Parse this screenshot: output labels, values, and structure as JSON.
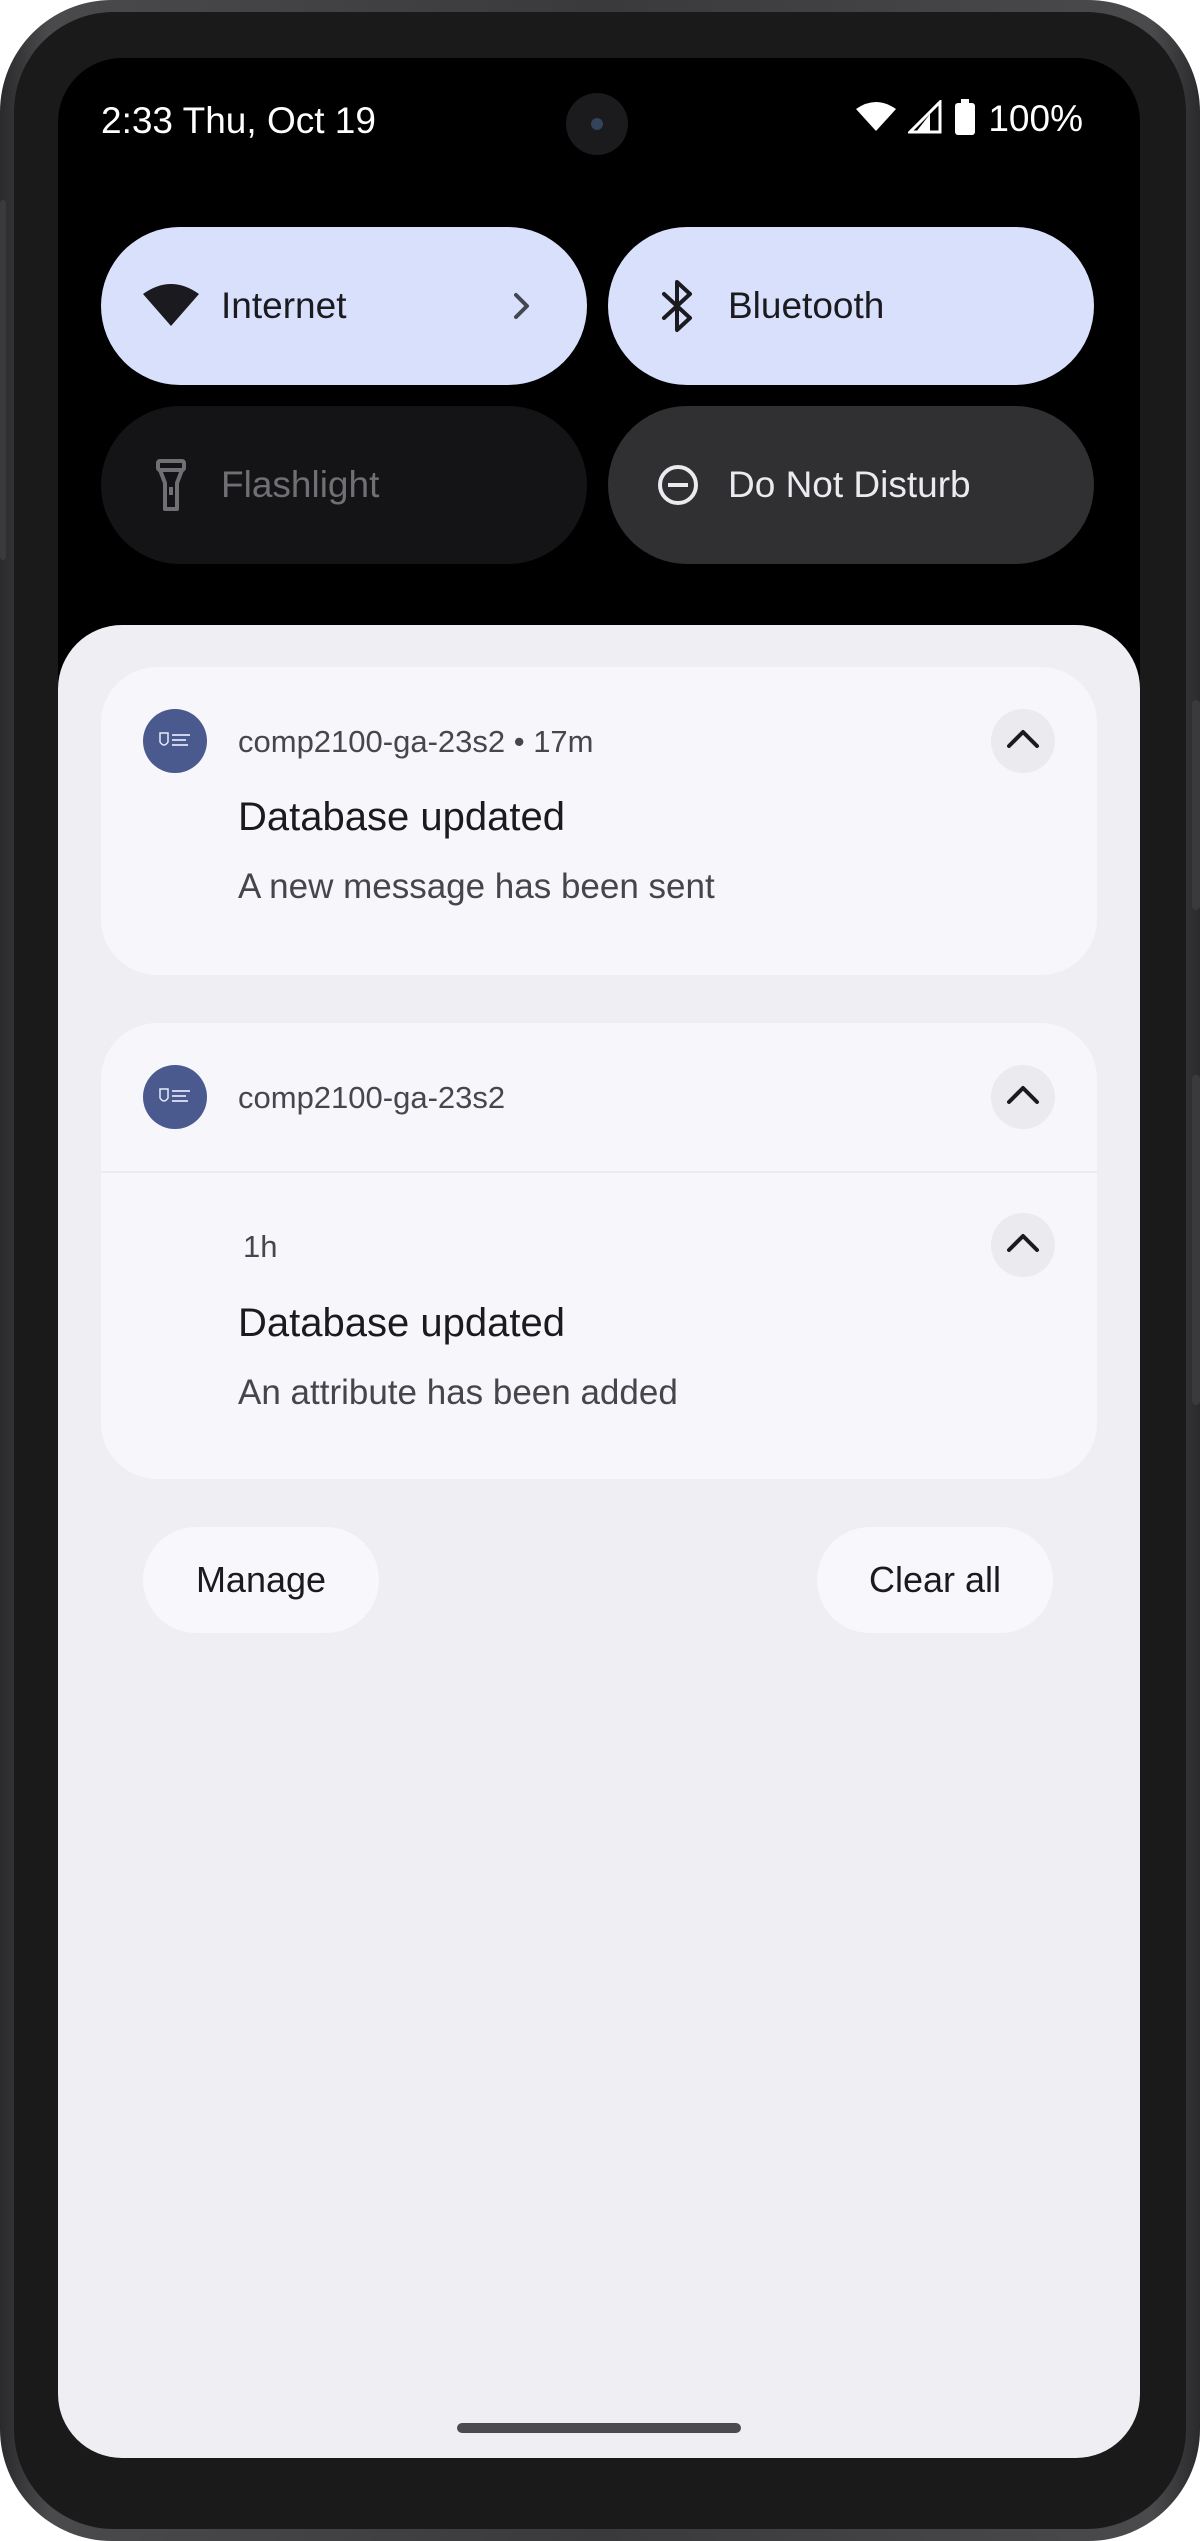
{
  "status_bar": {
    "time": "2:33 Thu, Oct 19",
    "battery": "100%",
    "icons": [
      "wifi-icon",
      "cell-signal-icon",
      "battery-icon"
    ]
  },
  "quick_settings": {
    "tiles": [
      {
        "label": "Internet",
        "icon": "wifi-icon",
        "state": "on",
        "has_chevron": true
      },
      {
        "label": "Bluetooth",
        "icon": "bluetooth-icon",
        "state": "on"
      },
      {
        "label": "Flashlight",
        "icon": "flashlight-icon",
        "state": "unavailable"
      },
      {
        "label": "Do Not Disturb",
        "icon": "do-not-disturb-icon",
        "state": "off"
      }
    ]
  },
  "notifications": [
    {
      "app": "comp2100-ga-23s2",
      "time": "17m",
      "header": "comp2100-ga-23s2 • 17m",
      "title": "Database updated",
      "text": "A new message has been sent"
    },
    {
      "app": "comp2100-ga-23s2",
      "group": {
        "time": "1h",
        "title": "Database updated",
        "text": "An attribute has been added"
      }
    }
  ],
  "actions": {
    "manage": "Manage",
    "clear_all": "Clear all"
  },
  "colors": {
    "tile_active": "#d8e0fb",
    "tile_inactive": "#141416",
    "tile_dnd": "#303033",
    "shade_bg": "#efeef3",
    "card_bg": "#f7f6fa",
    "app_icon_bg": "#4a5a8f"
  }
}
